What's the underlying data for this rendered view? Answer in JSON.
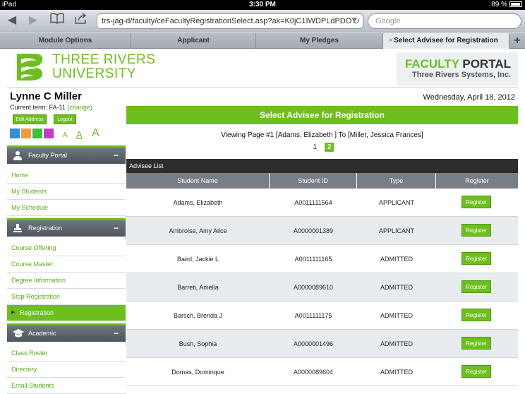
{
  "status_bar": {
    "device": "iPad",
    "time": "3:30 PM",
    "battery": "89 %"
  },
  "browser": {
    "url": "trs-jag-d/faculty/ceFacultyRegistrationSelect.asp?ak=K0jC1IWDPLdPDOY",
    "search_placeholder": "Google",
    "tabs": [
      "Module Options",
      "Applicant",
      "My Pledges",
      "Select Advisee for Registration"
    ],
    "tab_close": "×",
    "tab_add": "+"
  },
  "header": {
    "univ_line1": "THREE RIVERS",
    "univ_line2": "UNIVERSITY",
    "portal_word1": "FACULTY",
    "portal_word2": "PORTAL",
    "portal_sub": "Three Rivers Systems, Inc."
  },
  "user": {
    "name": "Lynne C Miller",
    "term_label": "Current term: FA-11",
    "change_link": "(change)",
    "edit_address": "Edit Address",
    "logout": "Logout",
    "date": "Wednesday, April 18, 2012",
    "swatch_colors": [
      "#2f8fd8",
      "#f39a3c",
      "#3cbf3a",
      "#c43bc6"
    ],
    "font_size_glyph": "A"
  },
  "sidebar": {
    "collapse_glyph": "−",
    "active_marker": "▶",
    "sections": [
      {
        "title": "Faculty Portal",
        "items": [
          "Home",
          "My Students",
          "My Schedule"
        ]
      },
      {
        "title": "Registration",
        "items": [
          "Course Offering",
          "Course Master",
          "Degree Information",
          "Stop Registration",
          "Registration"
        ]
      },
      {
        "title": "Academic",
        "items": [
          "Class Roster",
          "Directory",
          "Email Students"
        ]
      }
    ],
    "active_item": "Registration"
  },
  "main": {
    "title": "Select Advisee for Registration",
    "viewing": "Viewing Page #1 [Adams, Elizabeth ] To [Miller, Jessica Frances]",
    "pages": [
      "1",
      "2"
    ],
    "current_page": "2",
    "list_title": "Advisee List",
    "columns": [
      "Student Name",
      "Student ID",
      "Type",
      "Register"
    ],
    "register_label": "Register",
    "rows": [
      {
        "name": "Adams, Elizabeth",
        "id": "A0011111564",
        "type": "APPLICANT"
      },
      {
        "name": "Ambroise, Amy Alice",
        "id": "A0000001389",
        "type": "APPLICANT"
      },
      {
        "name": "Baird, Jackie L",
        "id": "A0011111165",
        "type": "ADMITTED"
      },
      {
        "name": "Barreti, Amelia",
        "id": "A0000089610",
        "type": "ADMITTED"
      },
      {
        "name": "Barsch, Brenda J",
        "id": "A0011111175",
        "type": "ADMITTED"
      },
      {
        "name": "Bush, Sophia",
        "id": "A0000001496",
        "type": "ADMITTED"
      },
      {
        "name": "Domas, Dominque",
        "id": "A0000089604",
        "type": "ADMITTED"
      }
    ]
  }
}
